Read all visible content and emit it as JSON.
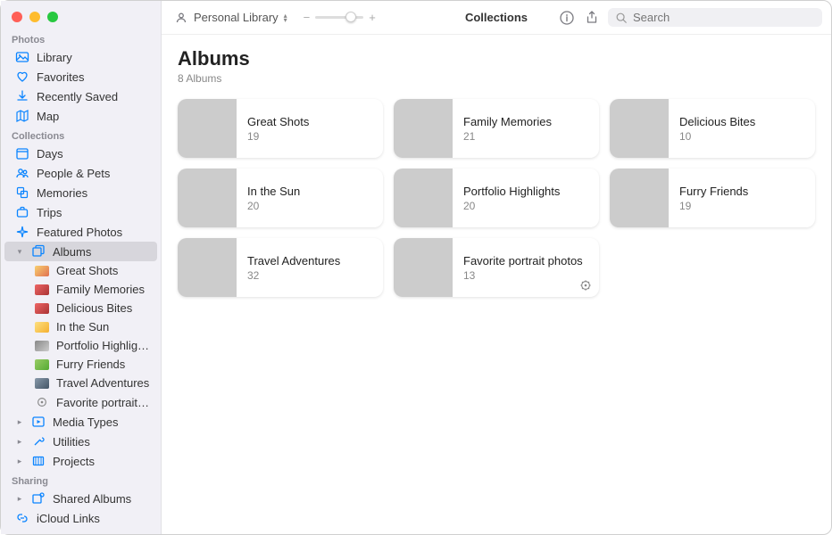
{
  "toolbar": {
    "library_label": "Personal Library",
    "center_title": "Collections",
    "search_placeholder": "Search"
  },
  "sidebar": {
    "sections": {
      "photos": {
        "header": "Photos",
        "items": [
          {
            "label": "Library"
          },
          {
            "label": "Favorites"
          },
          {
            "label": "Recently Saved"
          },
          {
            "label": "Map"
          }
        ]
      },
      "collections": {
        "header": "Collections",
        "items": [
          {
            "label": "Days"
          },
          {
            "label": "People & Pets"
          },
          {
            "label": "Memories"
          },
          {
            "label": "Trips"
          },
          {
            "label": "Featured Photos"
          },
          {
            "label": "Albums"
          },
          {
            "label": "Media Types"
          },
          {
            "label": "Utilities"
          },
          {
            "label": "Projects"
          }
        ],
        "album_children": [
          {
            "label": "Great Shots"
          },
          {
            "label": "Family Memories"
          },
          {
            "label": "Delicious Bites"
          },
          {
            "label": "In the Sun"
          },
          {
            "label": "Portfolio Highlights"
          },
          {
            "label": "Furry Friends"
          },
          {
            "label": "Travel Adventures"
          },
          {
            "label": "Favorite portrait photos"
          }
        ]
      },
      "sharing": {
        "header": "Sharing",
        "items": [
          {
            "label": "Shared Albums"
          },
          {
            "label": "iCloud Links"
          }
        ]
      }
    }
  },
  "main": {
    "title": "Albums",
    "subtitle": "8 Albums",
    "albums": [
      {
        "name": "Great Shots",
        "count": "19"
      },
      {
        "name": "Family Memories",
        "count": "21"
      },
      {
        "name": "Delicious Bites",
        "count": "10"
      },
      {
        "name": "In the Sun",
        "count": "20"
      },
      {
        "name": "Portfolio Highlights",
        "count": "20"
      },
      {
        "name": "Furry Friends",
        "count": "19"
      },
      {
        "name": "Travel Adventures",
        "count": "32"
      },
      {
        "name": "Favorite portrait photos",
        "count": "13"
      }
    ]
  }
}
